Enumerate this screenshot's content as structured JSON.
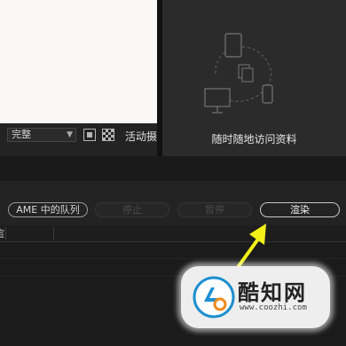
{
  "viewer": {
    "resolution_select": "完整",
    "active_camera_label": "活动摄像机"
  },
  "libraries_panel": {
    "caption": "随时随地访问资料"
  },
  "render_queue": {
    "ame_label": "AME 中的队列",
    "stop_label": "停止",
    "pause_label": "暂停",
    "render_label": "渲染",
    "header_fragment": "渲"
  },
  "annotation": {
    "arrow_color": "#f3f01a"
  },
  "watermark": {
    "name": "酷知网",
    "url": "www.coozhi.com",
    "brand_color": "#1c8fd0"
  }
}
